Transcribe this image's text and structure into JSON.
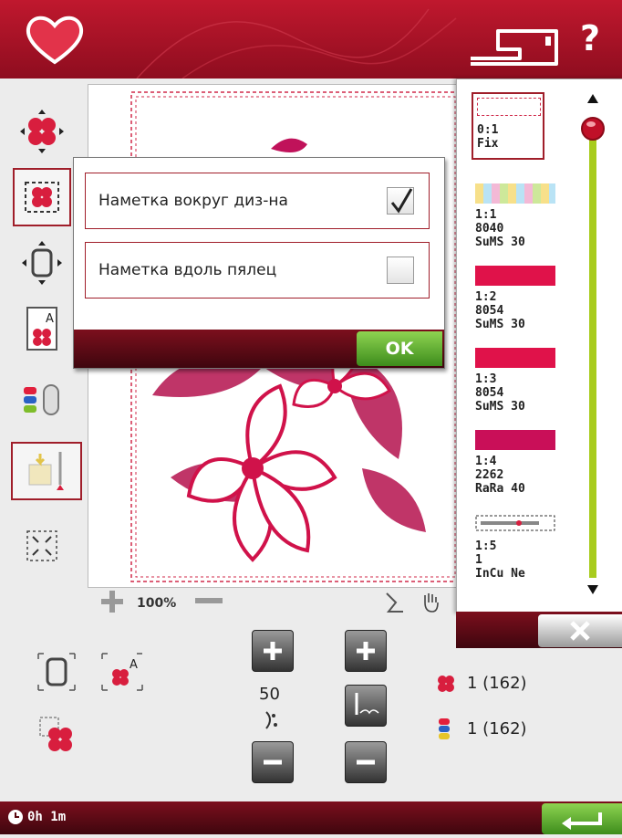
{
  "header": {
    "help_label": "?"
  },
  "dialog": {
    "option1_label": "Наметка вокруг диз-на",
    "option1_checked": true,
    "option2_label": "Наметка вдоль пялец",
    "option2_checked": false,
    "ok_label": "OK"
  },
  "zoom": {
    "level": "100%"
  },
  "thread_list": [
    {
      "num": "0:1",
      "code": "Fix",
      "name": "",
      "color": "#ffffff"
    },
    {
      "num": "1:1",
      "code": "8040",
      "name": "SuMS 30",
      "color": "multicolor"
    },
    {
      "num": "1:2",
      "code": "8054",
      "name": "SuMS 30",
      "color": "#e0124a"
    },
    {
      "num": "1:3",
      "code": "8054",
      "name": "SuMS 30",
      "color": "#e0124a"
    },
    {
      "num": "1:4",
      "code": "2262",
      "name": "RaRa 40",
      "color": "#c90f58"
    },
    {
      "num": "1:5",
      "code": "1",
      "name": "InCu Ne",
      "color": "needle"
    }
  ],
  "controls": {
    "stitch_value": "50"
  },
  "stats": {
    "stitches": "1 (162)",
    "colors": "1 (162)"
  },
  "footer": {
    "time": "0h 1m"
  },
  "colors": {
    "accent": "#a01e2a",
    "ok_green": "#5cae2e",
    "slider_green": "#a8cc1e"
  }
}
